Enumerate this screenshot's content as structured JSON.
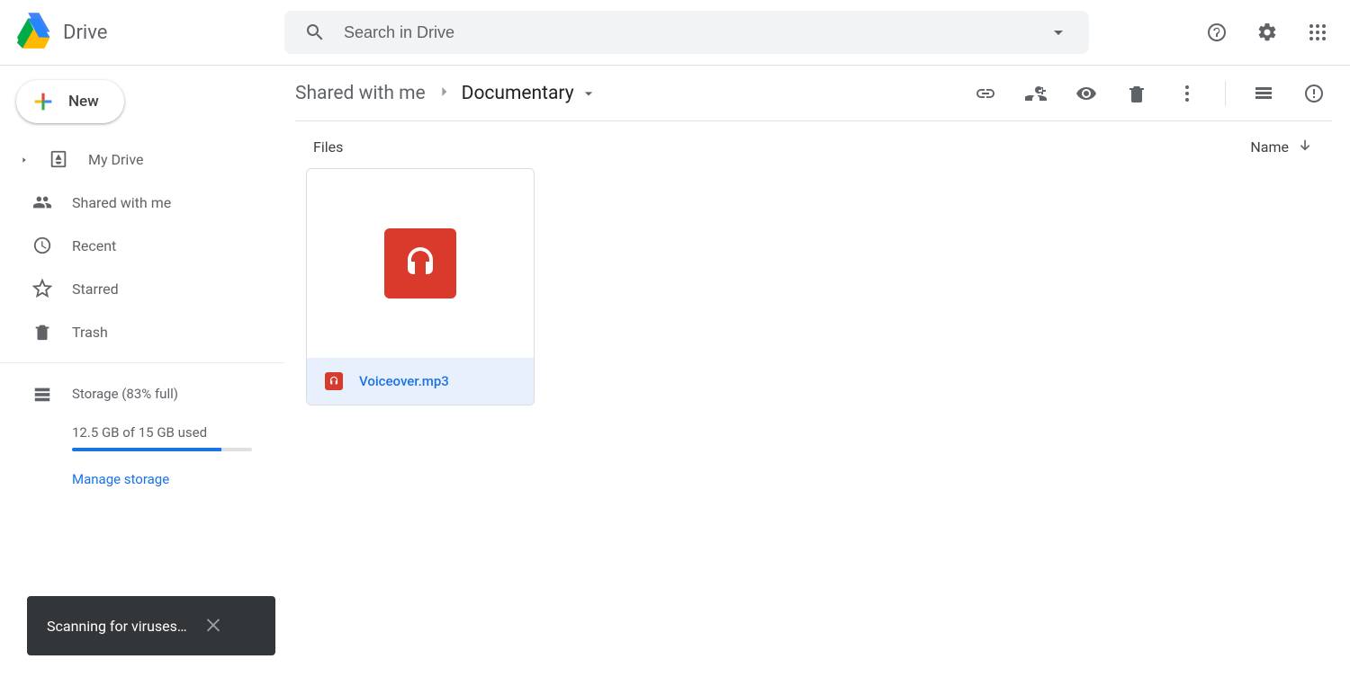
{
  "app_name": "Drive",
  "search": {
    "placeholder": "Search in Drive"
  },
  "sidebar": {
    "new_label": "New",
    "items": [
      {
        "label": "My Drive"
      },
      {
        "label": "Shared with me"
      },
      {
        "label": "Recent"
      },
      {
        "label": "Starred"
      },
      {
        "label": "Trash"
      }
    ],
    "storage": {
      "label": "Storage (83% full)",
      "used_text": "12.5 GB of 15 GB used",
      "percent": 83,
      "manage_label": "Manage storage"
    }
  },
  "breadcrumb": {
    "parent": "Shared with me",
    "current": "Documentary"
  },
  "columns": {
    "files_label": "Files",
    "name_label": "Name"
  },
  "files": [
    {
      "name": "Voiceover.mp3",
      "type": "audio",
      "selected": true
    }
  ],
  "toast": {
    "message": "Scanning for viruses…"
  }
}
